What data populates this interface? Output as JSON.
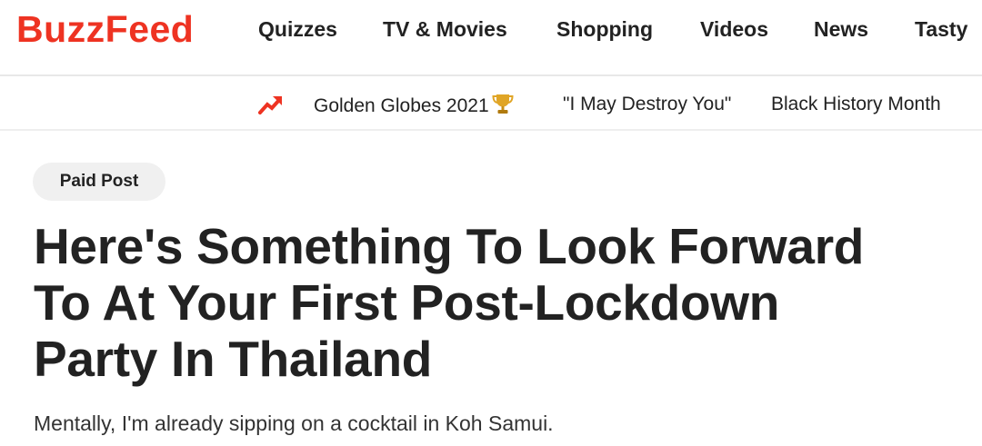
{
  "brand": {
    "logo_text": "BuzzFeed",
    "logo_color": "#ee3322"
  },
  "nav": {
    "items": [
      {
        "label": "Quizzes"
      },
      {
        "label": "TV & Movies"
      },
      {
        "label": "Shopping"
      },
      {
        "label": "Videos"
      },
      {
        "label": "News"
      },
      {
        "label": "Tasty"
      }
    ]
  },
  "trending": {
    "icon": "trending-arrow-icon",
    "icon_color": "#ee3322",
    "items": [
      {
        "label": "Golden Globes 2021",
        "icon": "trophy-icon"
      },
      {
        "label": "\"I May Destroy You\""
      },
      {
        "label": "Black History Month"
      }
    ]
  },
  "article": {
    "badge": "Paid Post",
    "headline": "Here's Something To Look Forward To At Your First Post-Lockdown Party In Thailand",
    "subtitle": "Mentally, I'm already sipping on a cocktail in Koh Samui."
  }
}
